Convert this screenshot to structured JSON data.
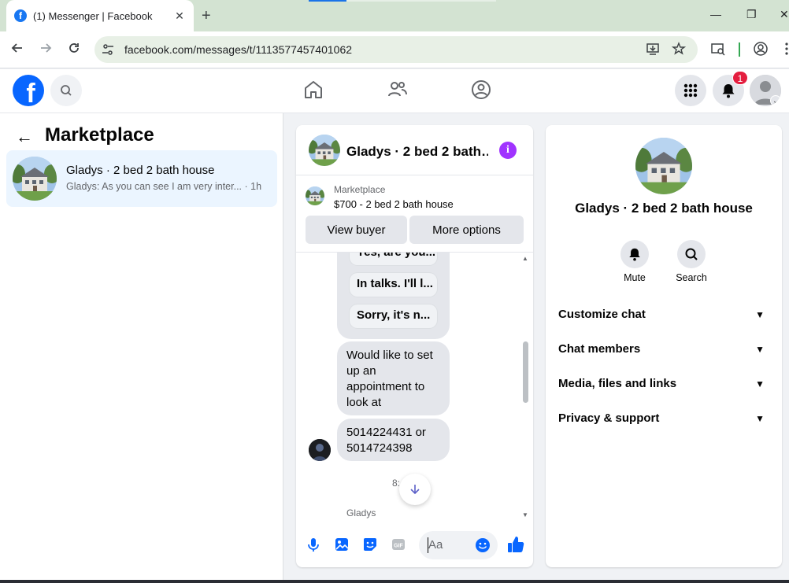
{
  "browser": {
    "tab_title": "(1) Messenger | Facebook",
    "tab_close": "✕",
    "new_tab": "+",
    "url": "facebook.com/messages/t/1113577457401062",
    "win_min": "—",
    "win_max": "❐",
    "win_close": "✕"
  },
  "header": {
    "notification_count": "1"
  },
  "sidebar": {
    "back_arrow": "←",
    "title": "Marketplace",
    "conversations": [
      {
        "name": "Gladys · 2 bed 2 bath house",
        "preview": "Gladys: As you can see I am very inter... · 1h"
      }
    ]
  },
  "chat": {
    "title": "Gladys · 2 bed 2 bath…",
    "info_icon": "i",
    "marketplace_label": "Marketplace",
    "listing": "$700 - 2 bed 2 bath house",
    "view_buyer": "View buyer",
    "more_options": "More options",
    "quick_replies": [
      "Yes, are you...",
      "In talks. I'll l...",
      "Sorry, it's n..."
    ],
    "messages": [
      "Would like to set up an appointment to look at",
      "5014224431 or 5014724398"
    ],
    "time": "8:",
    "seen_by": "Gladys",
    "composer_placeholder": "Aa"
  },
  "info_panel": {
    "name": "Gladys · 2 bed 2 bath house",
    "actions": [
      {
        "label": "Mute",
        "icon": "bell-icon"
      },
      {
        "label": "Search",
        "icon": "search-icon"
      }
    ],
    "sections": [
      "Customize chat",
      "Chat members",
      "Media, files and links",
      "Privacy & support"
    ],
    "chevron": "⌄"
  },
  "colors": {
    "facebook_blue": "#0866ff",
    "messenger_purple": "#a033ff",
    "notification_red": "#e41e3f",
    "selected_conv": "#ebf5ff"
  }
}
